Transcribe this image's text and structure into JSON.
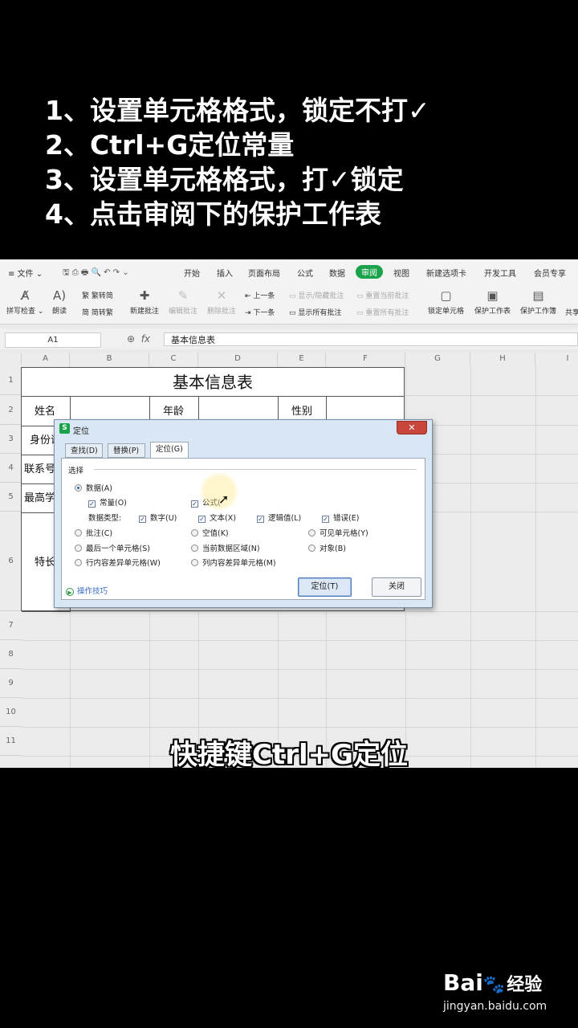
{
  "overlay": {
    "steps": [
      "1、设置单元格格式，锁定不打✓",
      "2、Ctrl+G定位常量",
      "3、设置单元格格式，打✓锁定",
      "4、点击审阅下的保护工作表"
    ],
    "subtitle": "快捷键Ctrl+G定位",
    "watermark": {
      "brand": "Bai",
      "paw": "🐾",
      "cn": "经验",
      "url": "jingyan.baidu.com"
    }
  },
  "menubar": {
    "file": "≡ 文件 ⌄",
    "quick_icons": "🖫  ⎙  🖶  🔍  ↶  ↷  ⌄",
    "tabs": [
      "开始",
      "插入",
      "页面布局",
      "公式",
      "数据",
      "审阅",
      "视图",
      "新建选项卡",
      "开发工具",
      "会员专享"
    ],
    "active_tab": "审阅"
  },
  "ribbon": {
    "spell": "拼写检查 ⌄",
    "read": "朗读",
    "trad2simp": "繁转简",
    "simp2trad": "简转繁",
    "new_comment": "新建批注",
    "edit_comment": "编辑批注",
    "delete_comment": "删除批注",
    "prev": "上一条",
    "next": "下一条",
    "show_hide": "显示/隐藏批注",
    "show_all": "显示所有批注",
    "reset_current": "重置当前批注",
    "reset_all": "重置所有批注",
    "lock_cell": "锁定单元格",
    "protect_sheet": "保护工作表",
    "protect_book": "保护工作簿",
    "share": "共享"
  },
  "formula_bar": {
    "name_box": "A1",
    "fx": "fx",
    "content": "基本信息表"
  },
  "sheet": {
    "columns": [
      "A",
      "B",
      "C",
      "D",
      "E",
      "F",
      "G",
      "H",
      "I"
    ],
    "rows": [
      "1",
      "2",
      "3",
      "4",
      "5",
      "6",
      "7",
      "8",
      "9",
      "10",
      "11"
    ],
    "title": "基本信息表",
    "labels": {
      "name": "姓名",
      "age": "年龄",
      "gender": "性别",
      "id": "身份证",
      "phone": "联系号",
      "edu": "最高学",
      "skills": "特长"
    }
  },
  "dialog": {
    "title": "定位",
    "close": "✕",
    "tabs": [
      "查找(D)",
      "替换(P)",
      "定位(G)"
    ],
    "active_tab": "定位(G)",
    "section": "选择",
    "radio_data": "数据(A)",
    "check_constant": "常量(O)",
    "check_formula": "公式(",
    "data_types_label": "数据类型:",
    "check_number": "数字(U)",
    "check_text": "文本(X)",
    "check_logic": "逻辑值(L)",
    "check_error": "错误(E)",
    "radio_comment": "批注(C)",
    "radio_blank": "空值(K)",
    "radio_visible": "可见单元格(Y)",
    "radio_last": "最后一个单元格(S)",
    "radio_region": "当前数据区域(N)",
    "radio_object": "对象(B)",
    "radio_row_diff": "行内容差异单元格(W)",
    "radio_col_diff": "列内容差异单元格(M)",
    "tip": "操作技巧",
    "btn_locate": "定位(T)",
    "btn_close": "关闭",
    "check_mark": "✓"
  }
}
